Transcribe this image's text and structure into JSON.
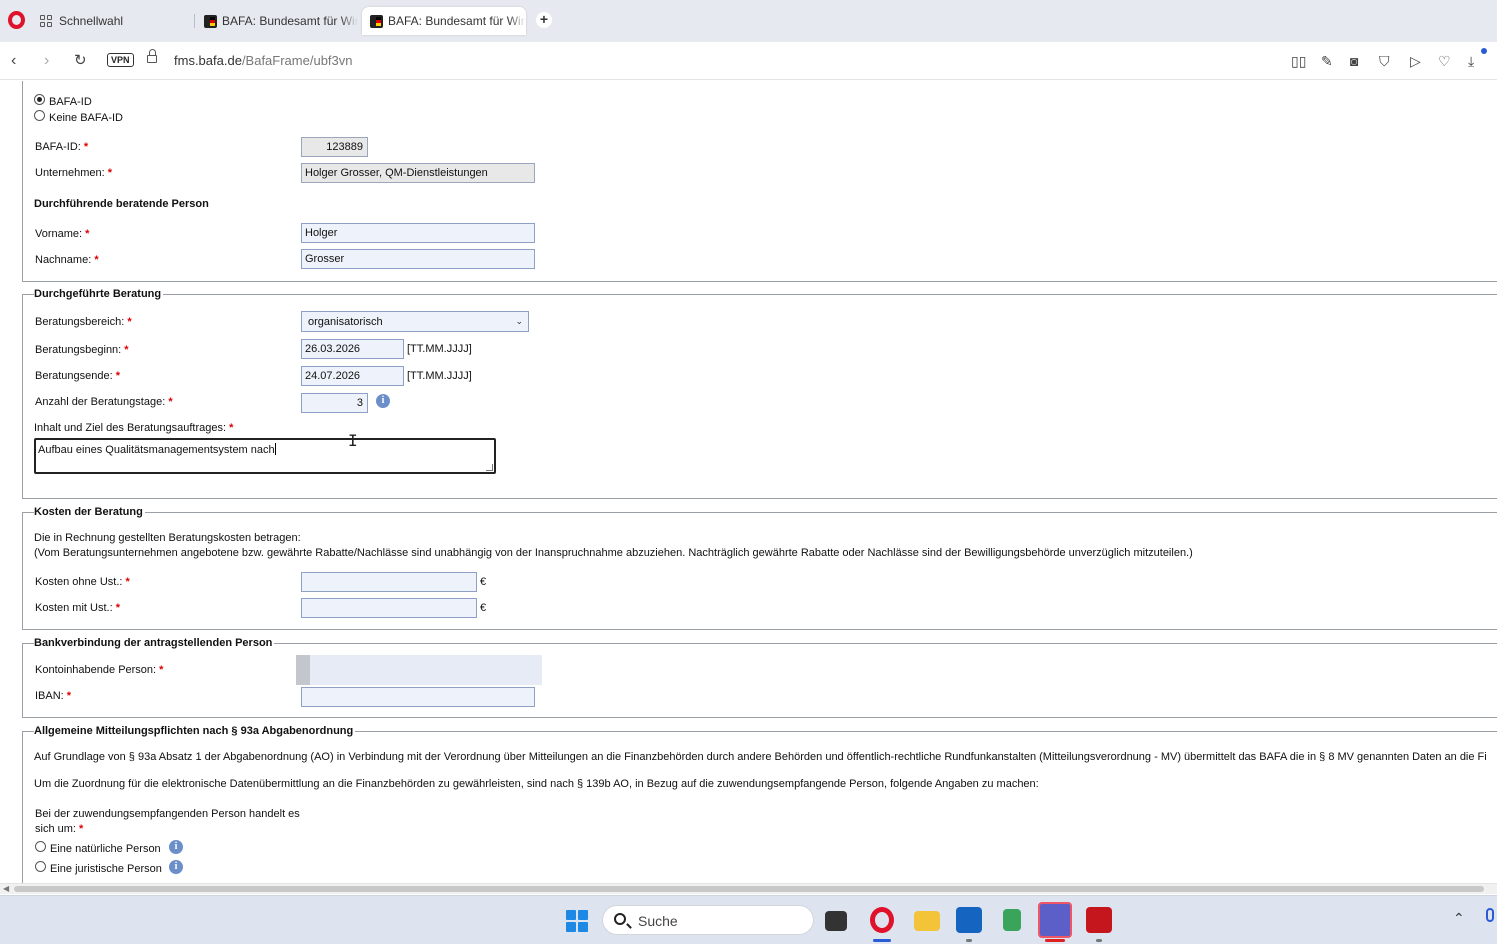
{
  "browser": {
    "tabs": [
      {
        "label": "Schnellwahl"
      },
      {
        "label": "BAFA: Bundesamt für Wirt"
      },
      {
        "label": "BAFA: Bundesamt für Wirt"
      }
    ],
    "new_tab_label": "+",
    "vpn_label": "VPN",
    "url_host": "fms.bafa.de",
    "url_path": "/BafaFrame/ubf3vn"
  },
  "form": {
    "id_options": [
      "BAFA-ID",
      "Keine BAFA-ID"
    ],
    "bafa_id": {
      "label": "BAFA-ID:",
      "value": "123889"
    },
    "unternehmen": {
      "label": "Unternehmen:",
      "value": "Holger Grosser, QM-Dienstleistungen"
    },
    "person_heading": "Durchführende beratende Person",
    "vorname": {
      "label": "Vorname:",
      "value": "Holger"
    },
    "nachname": {
      "label": "Nachname:",
      "value": "Grosser"
    },
    "beratung": {
      "legend": "Durchgeführte Beratung",
      "bereich": {
        "label": "Beratungsbereich:",
        "value": "organisatorisch"
      },
      "beginn": {
        "label": "Beratungsbeginn:",
        "value": "26.03.2026",
        "hint": "[TT.MM.JJJJ]"
      },
      "ende": {
        "label": "Beratungsende:",
        "value": "24.07.2026",
        "hint": "[TT.MM.JJJJ]"
      },
      "tage": {
        "label": "Anzahl der Beratungstage:",
        "value": "3"
      },
      "inhalt": {
        "label": "Inhalt und Ziel des Beratungsauftrages:",
        "value": "Aufbau eines Qualitätsmanagementsystem nach"
      }
    },
    "kosten": {
      "legend": "Kosten der Beratung",
      "intro1": "Die in Rechnung gestellten Beratungskosten betragen:",
      "intro2": "(Vom Beratungsunternehmen angebotene bzw. gewährte Rabatte/Nachlässe sind unabhängig von der Inanspruchnahme abzuziehen. Nachträglich gewährte Rabatte oder Nachlässe sind der Bewilligungsbehörde unverzüglich mitzuteilen.)",
      "ohne": {
        "label": "Kosten ohne Ust.:",
        "value": "",
        "unit": "€"
      },
      "mit": {
        "label": "Kosten mit Ust.:",
        "value": "",
        "unit": "€"
      }
    },
    "bank": {
      "legend": "Bankverbindung der antragstellenden Person",
      "inhaber": {
        "label": "Kontoinhabende Person:"
      },
      "iban": {
        "label": "IBAN:",
        "value": ""
      }
    },
    "abgabe": {
      "legend": "Allgemeine Mitteilungspflichten nach § 93a Abgabenordnung",
      "p1": "Auf Grundlage von § 93a Absatz 1 der Abgabenordnung (AO) in Verbindung mit der Verordnung über Mitteilungen an die Finanzbehörden durch andere Behörden und öffentlich-rechtliche Rundfunkanstalten (Mitteilungsverordnung - MV) übermittelt das BAFA die in § 8 MV genannten Daten an die Fi",
      "p2": "Um die Zuordnung für die elektronische Datenübermittlung an die Finanzbehörden zu gewährleisten, sind nach § 139b AO, in Bezug auf die zuwendungsempfangende Person, folgende Angaben zu machen:",
      "q1": "Bei der zuwendungsempfangenden Person handelt es",
      "q2": "sich um:",
      "options": [
        "Eine natürliche Person",
        "Eine juristische Person"
      ]
    },
    "required_mark": "*",
    "info_glyph": "i"
  },
  "taskbar": {
    "search_label": "Suche"
  },
  "colors": {
    "required": "#dd0000",
    "field_bg": "#eef3fb",
    "opera_red": "#e0112b",
    "windows_blue": "#1e88e5"
  }
}
